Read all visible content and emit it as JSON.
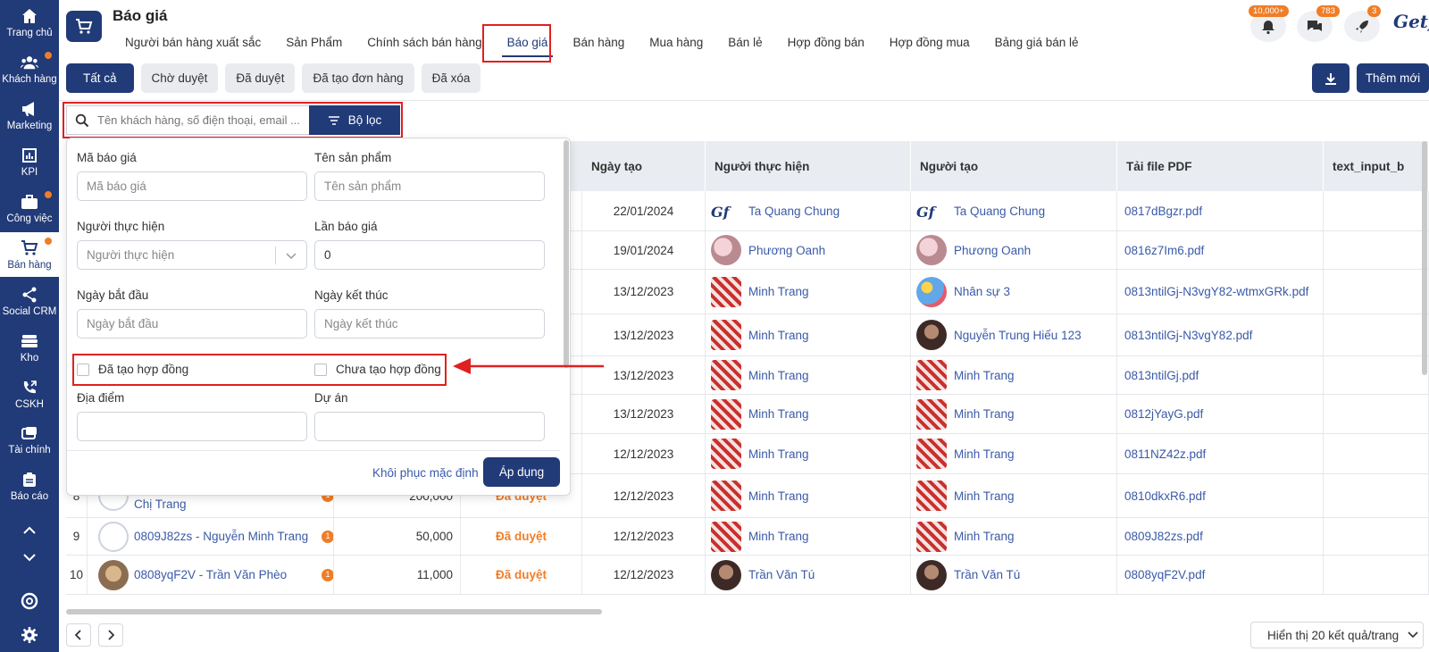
{
  "nav": {
    "items": [
      {
        "label": "Trang chủ",
        "icon": "home-icon",
        "dot": false
      },
      {
        "label": "Khách hàng",
        "icon": "users-icon",
        "dot": true
      },
      {
        "label": "Marketing",
        "icon": "megaphone-icon",
        "dot": false
      },
      {
        "label": "KPI",
        "icon": "chart-icon",
        "dot": false
      },
      {
        "label": "Công việc",
        "icon": "briefcase-icon",
        "dot": true
      },
      {
        "label": "Bán hàng",
        "icon": "cart-icon",
        "dot": true
      },
      {
        "label": "Social CRM",
        "icon": "share-icon",
        "dot": false
      },
      {
        "label": "Kho",
        "icon": "warehouse-icon",
        "dot": false
      },
      {
        "label": "CSKH",
        "icon": "phone-icon",
        "dot": false
      },
      {
        "label": "Tài chính",
        "icon": "finance-icon",
        "dot": false
      },
      {
        "label": "Báo cáo",
        "icon": "clipboard-icon",
        "dot": false
      }
    ]
  },
  "header": {
    "title": "Báo giá",
    "brand": "Getfly",
    "badges": {
      "notifications": "10,000+",
      "messages": "783",
      "launch": "3"
    },
    "tabs": [
      "Người bán hàng xuất sắc",
      "Sản Phẩm",
      "Chính sách bán hàng",
      "Báo giá",
      "Bán hàng",
      "Mua hàng",
      "Bán lẻ",
      "Hợp đồng bán",
      "Hợp đồng mua",
      "Bảng giá bán lẻ"
    ],
    "active_tab": "Báo giá"
  },
  "status_filters": [
    "Tất cả",
    "Chờ duyệt",
    "Đã duyệt",
    "Đã tạo đơn hàng",
    "Đã xóa"
  ],
  "actions": {
    "add": "Thêm mới"
  },
  "search": {
    "placeholder": "Tên khách hàng, số điện thoại, email ...",
    "filter_button": "Bộ lọc"
  },
  "filter_panel": {
    "quote_code_label": "Mã báo giá",
    "quote_code_placeholder": "Mã báo giá",
    "product_label": "Tên sản phẩm",
    "product_placeholder": "Tên sản phẩm",
    "assignee_label": "Người thực hiện",
    "assignee_placeholder": "Người thực hiện",
    "times_label": "Lần báo giá",
    "times_value": "0",
    "start_label": "Ngày bắt đầu",
    "start_placeholder": "Ngày bắt đầu",
    "end_label": "Ngày kết thúc",
    "end_placeholder": "Ngày kết thúc",
    "contract_created": "Đã tạo hợp đồng",
    "contract_not_created": "Chưa tạo hợp đồng",
    "location_label": "Địa điểm",
    "project_label": "Dự án",
    "reset": "Khôi phục mặc định",
    "apply": "Áp dụng"
  },
  "table": {
    "headers": [
      "Ngày tạo",
      "Người thực hiện",
      "Người tạo",
      "Tải file PDF",
      "text_input_b"
    ],
    "rows": [
      {
        "no": "",
        "customer": "",
        "cust_count": "",
        "amount": "",
        "status": "",
        "date": "22/01/2024",
        "assignee": "Ta Quang Chung",
        "assignee_av": "logo",
        "creator": "Ta Quang Chung",
        "creator_av": "logo",
        "pdf": "0817dBgzr.pdf"
      },
      {
        "no": "",
        "customer": "",
        "cust_count": "",
        "amount": "",
        "status": "",
        "date": "19/01/2024",
        "assignee": "Phương Oanh",
        "assignee_av": "pink",
        "creator": "Phương Oanh",
        "creator_av": "pink",
        "pdf": "0816z7Im6.pdf"
      },
      {
        "no": "",
        "customer": "",
        "cust_count": "",
        "amount": "",
        "status": "",
        "date": "13/12/2023",
        "assignee": "Minh Trang",
        "assignee_av": "red",
        "creator": "Nhân sự 3",
        "creator_av": "blue",
        "pdf": "0813ntilGj-N3vgY82-wtmxGRk.pdf"
      },
      {
        "no": "",
        "customer": "",
        "cust_count": "",
        "amount": "",
        "status": "",
        "date": "13/12/2023",
        "assignee": "Minh Trang",
        "assignee_av": "red",
        "creator": "Nguyễn Trung Hiếu 123",
        "creator_av": "dark",
        "pdf": "0813ntilGj-N3vgY82.pdf"
      },
      {
        "no": "",
        "customer": "",
        "cust_count": "",
        "amount": "",
        "status": "",
        "date": "13/12/2023",
        "assignee": "Minh Trang",
        "assignee_av": "red",
        "creator": "Minh Trang",
        "creator_av": "red",
        "pdf": "0813ntilGj.pdf"
      },
      {
        "no": "",
        "customer": "",
        "cust_count": "",
        "amount": "",
        "status": "",
        "date": "13/12/2023",
        "assignee": "Minh Trang",
        "assignee_av": "red",
        "creator": "Minh Trang",
        "creator_av": "red",
        "pdf": "0812jYayG.pdf"
      },
      {
        "no": "",
        "customer": "",
        "cust_count": "",
        "amount": "",
        "status": "",
        "date": "12/12/2023",
        "assignee": "Minh Trang",
        "assignee_av": "red",
        "creator": "Minh Trang",
        "creator_av": "red",
        "pdf": "0811NZ42z.pdf"
      },
      {
        "no": "8",
        "customer": "0810dkxR6 - Phạm Thùy Trang Chị Trang",
        "cust_count": "1",
        "amount": "200,000",
        "status": "Đã duyệt",
        "date": "12/12/2023",
        "assignee": "Minh Trang",
        "assignee_av": "red",
        "creator": "Minh Trang",
        "creator_av": "red",
        "pdf": "0810dkxR6.pdf"
      },
      {
        "no": "9",
        "customer": "0809J82zs - Nguyễn Minh Trang",
        "cust_count": "1",
        "amount": "50,000",
        "status": "Đã duyệt",
        "date": "12/12/2023",
        "assignee": "Minh Trang",
        "assignee_av": "red",
        "creator": "Minh Trang",
        "creator_av": "red",
        "pdf": "0809J82zs.pdf"
      },
      {
        "no": "10",
        "customer": "0808yqF2V - Trần Văn Phèo",
        "cust_count": "1",
        "amount": "11,000",
        "status": "Đã duyệt",
        "date": "12/12/2023",
        "assignee": "Trần Văn Tú",
        "assignee_av": "dark",
        "creator": "Trần Văn Tú",
        "creator_av": "dark",
        "pdf": "0808yqF2V.pdf"
      }
    ]
  },
  "pager": {
    "page_size": "Hiển thị 20 kết quả/trang"
  },
  "colors": {
    "primary": "#213a78",
    "accent": "#f07d27",
    "highlight": "#e02020",
    "link": "#3a5aa8"
  }
}
